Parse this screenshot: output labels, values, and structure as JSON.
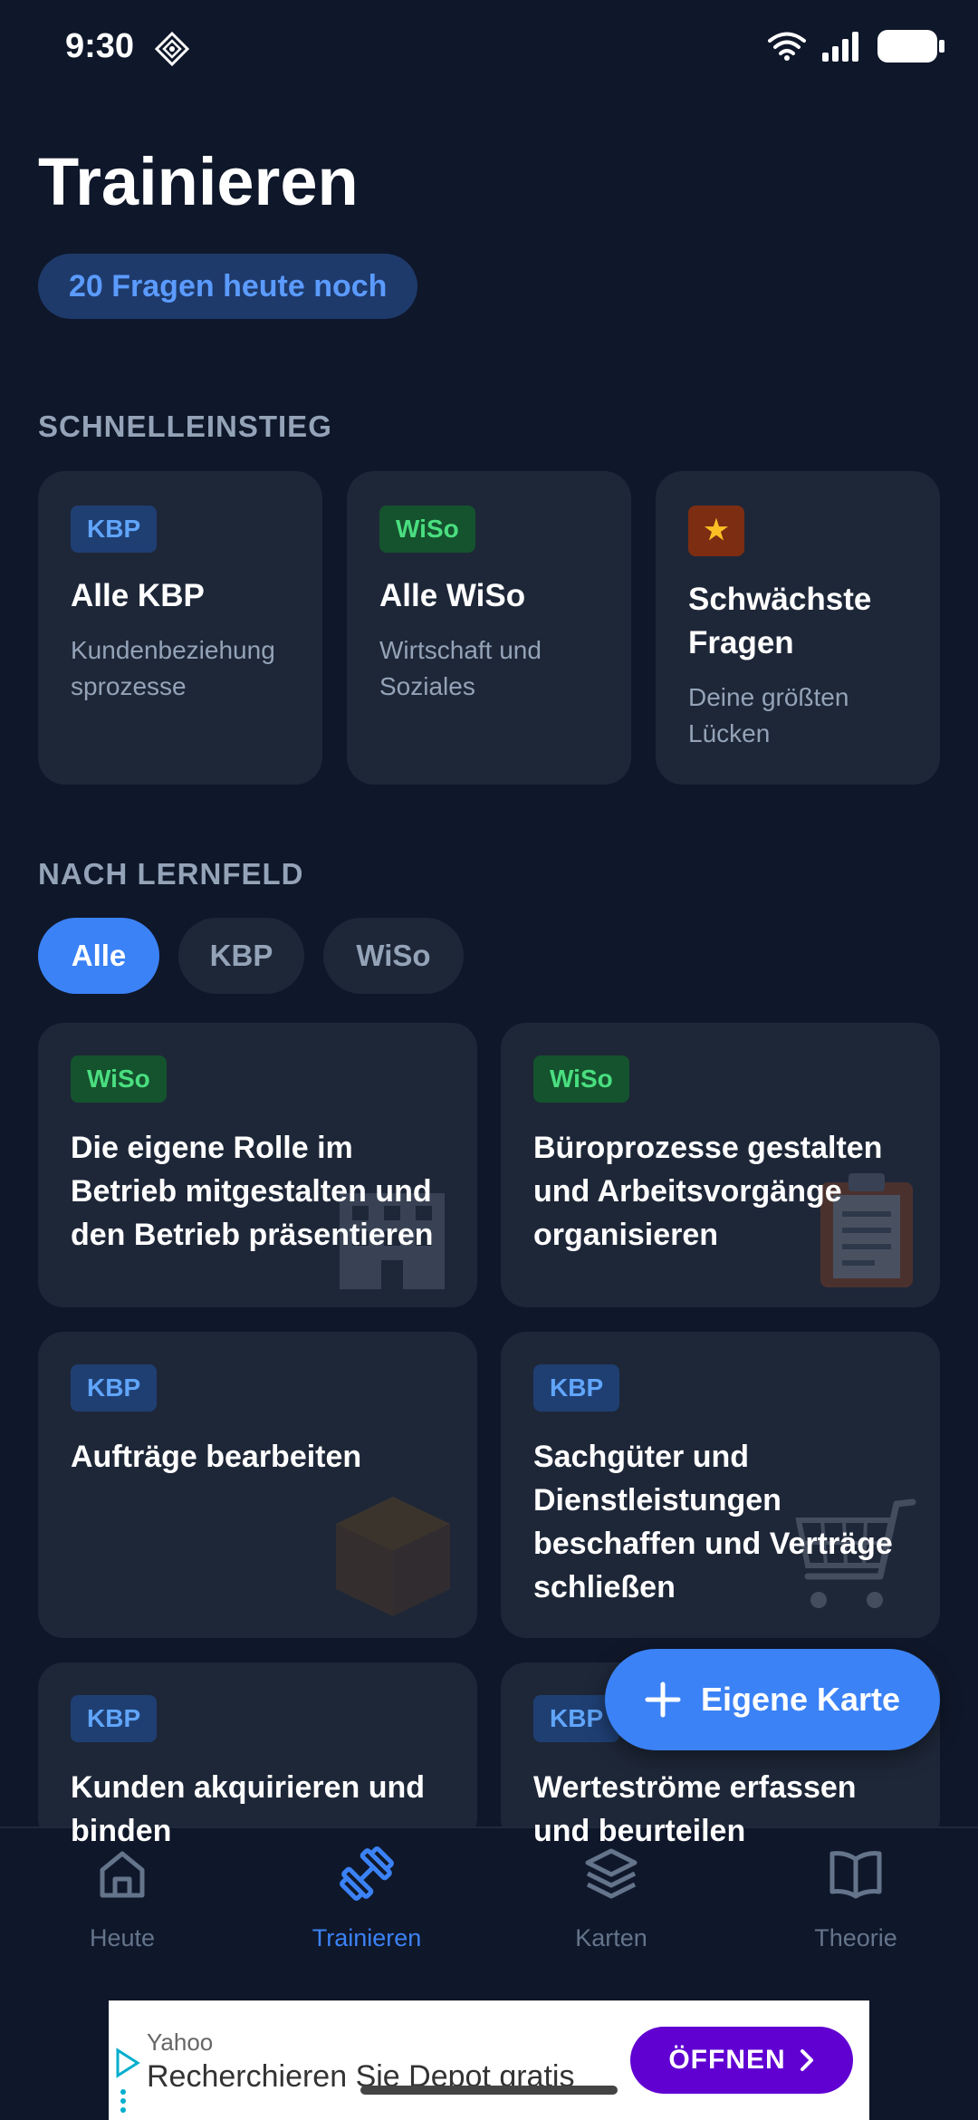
{
  "status": {
    "time": "9:30"
  },
  "header": {
    "title": "Trainieren",
    "remaining": "20 Fragen heute noch"
  },
  "quick": {
    "label": "SCHNELLEINSTIEG",
    "cards": [
      {
        "tag": "KBP",
        "title": "Alle KBP",
        "subtitle": "Kundenbeziehung sprozesse"
      },
      {
        "tag": "WiSo",
        "title": "Alle WiSo",
        "subtitle": "Wirtschaft und Soziales"
      },
      {
        "tag": "★",
        "title": "Schwächste Fragen",
        "subtitle": "Deine größten Lücken"
      }
    ]
  },
  "lernfeld": {
    "label": "NACH LERNFELD",
    "filters": [
      "Alle",
      "KBP",
      "WiSo"
    ],
    "active_filter": "Alle",
    "cards": [
      {
        "tag": "WiSo",
        "title": "Die eigene Rolle im Betrieb mitgestalten und den Betrieb präsentieren",
        "icon": "building-icon"
      },
      {
        "tag": "WiSo",
        "title": "Büroprozesse gestalten und Arbeitsvorgänge organisieren",
        "icon": "clipboard-icon"
      },
      {
        "tag": "KBP",
        "title": "Aufträge bearbeiten",
        "icon": "package-icon"
      },
      {
        "tag": "KBP",
        "title": "Sachgüter und Dienstleistungen beschaffen und Verträge schließen",
        "icon": "cart-icon"
      },
      {
        "tag": "KBP",
        "title": "Kunden akquirieren und binden",
        "icon": "handshake-icon"
      },
      {
        "tag": "KBP",
        "title": "Werteströme erfassen und beurteilen",
        "icon": "chart-icon"
      }
    ]
  },
  "fab": {
    "label": "Eigene Karte"
  },
  "tabs": [
    {
      "label": "Heute",
      "icon": "home-icon"
    },
    {
      "label": "Trainieren",
      "icon": "dumbbell-icon",
      "active": true
    },
    {
      "label": "Karten",
      "icon": "layers-icon"
    },
    {
      "label": "Theorie",
      "icon": "book-icon"
    }
  ],
  "ad": {
    "source": "Yahoo",
    "text": "Recherchieren Sie Depot gratis",
    "button": "ÖFFNEN"
  },
  "colors": {
    "background": "#0f172a",
    "card": "#1e2738",
    "accent": "#3b82f6",
    "kbp": "#60a5fa",
    "wiso": "#4ade80"
  }
}
